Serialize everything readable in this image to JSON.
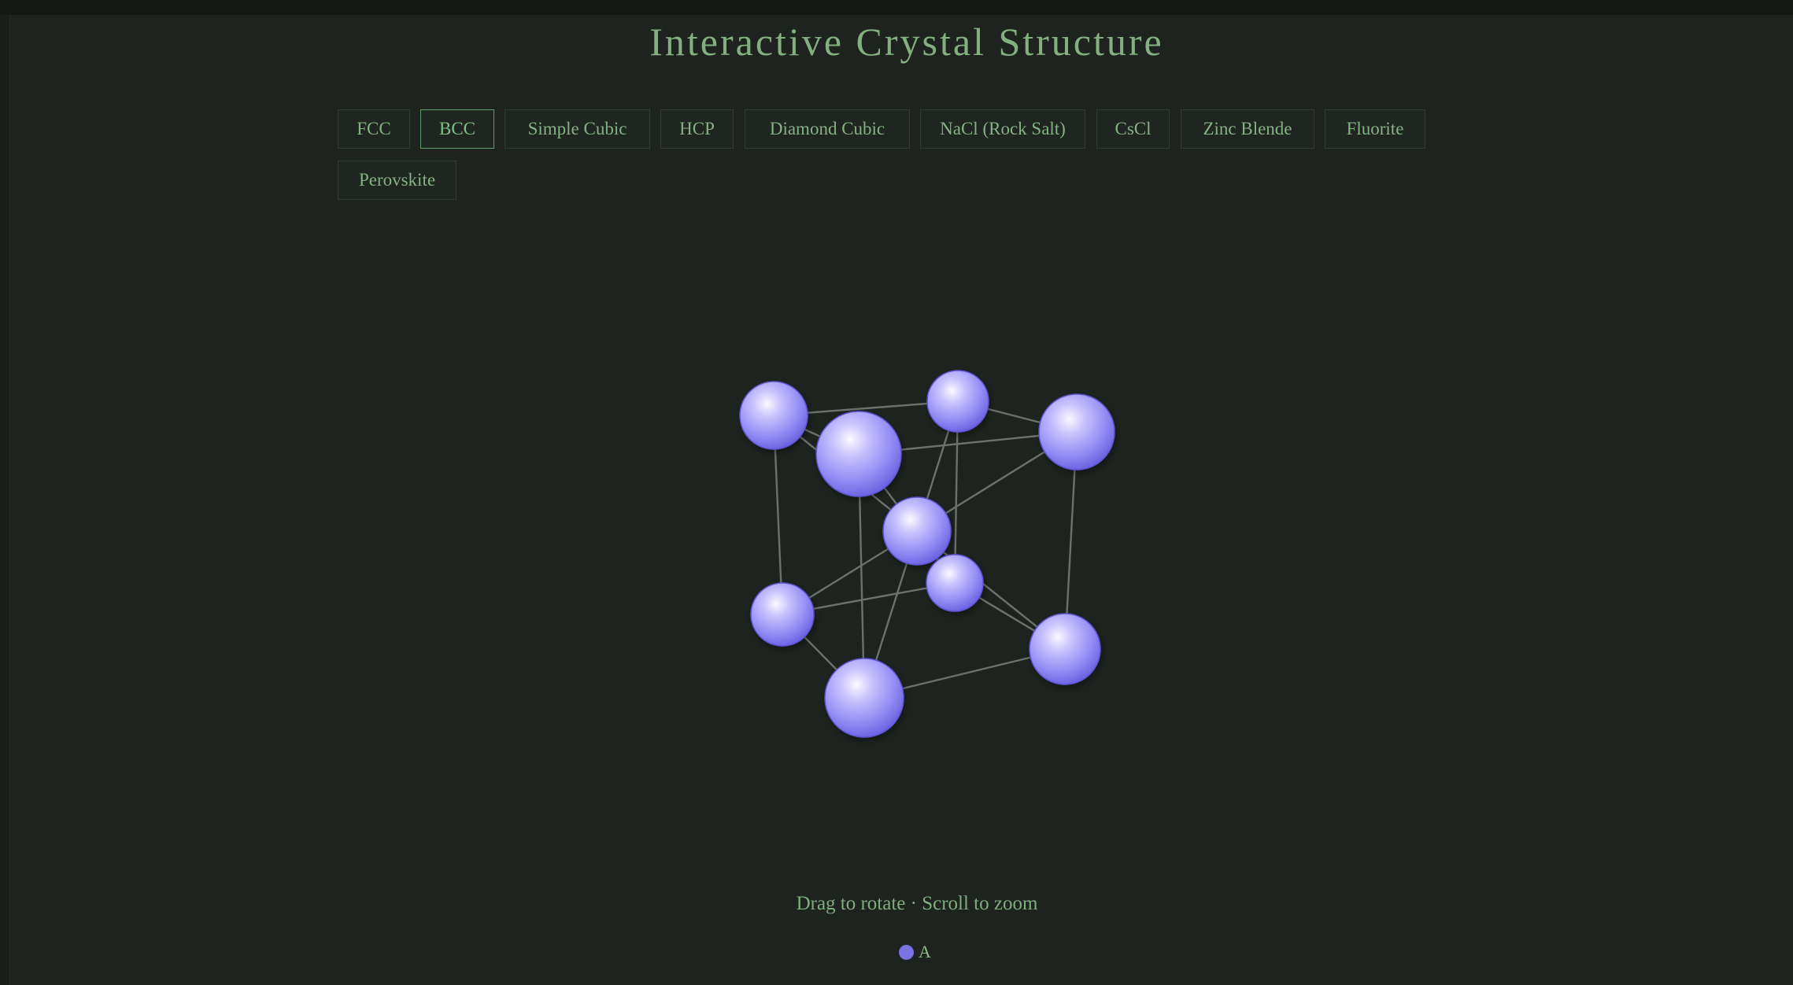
{
  "page": {
    "title": "Interactive Crystal Structure",
    "hint": "Drag to rotate · Scroll to zoom"
  },
  "structures": [
    {
      "label": "FCC",
      "active": false
    },
    {
      "label": "BCC",
      "active": true
    },
    {
      "label": "Simple Cubic",
      "active": false
    },
    {
      "label": "HCP",
      "active": false
    },
    {
      "label": "Diamond Cubic",
      "active": false
    },
    {
      "label": "NaCl (Rock Salt)",
      "active": false
    },
    {
      "label": "CsCl",
      "active": false
    },
    {
      "label": "Zinc Blende",
      "active": false
    },
    {
      "label": "Fluorite",
      "active": false
    },
    {
      "label": "Perovskite",
      "active": false
    }
  ],
  "legend": [
    {
      "label": "A",
      "color": "#7b72e6"
    }
  ],
  "colors": {
    "accent": "#83b07f",
    "atom": "#8d85f2",
    "bond": "#6c716d"
  }
}
